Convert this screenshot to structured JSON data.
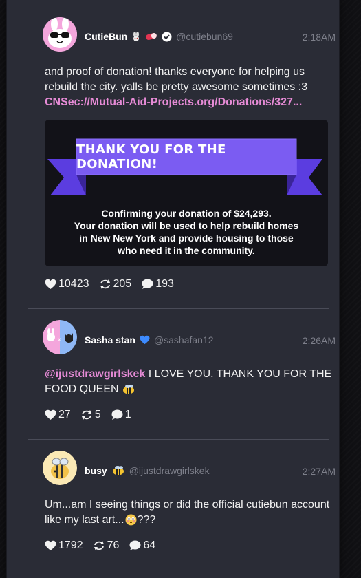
{
  "posts": [
    {
      "name": "CutieBun",
      "handle": "@cutiebun69",
      "time": "2:18AM",
      "text": "and proof of donation! thanks everyone for helping us rebuild the city. yalls be pretty awesome sometimes :3",
      "link": "CNSec://Mutual-Aid-Projects.org/Donations/327...",
      "card": {
        "banner": "THANK YOU FOR THE DONATION!",
        "line1": "Confirming your donation of $24,293.",
        "line2": "Your donation will be used to help rebuild homes",
        "line3": "in New New York and provide housing to those",
        "line4": "who need it in the community."
      },
      "likes": "10423",
      "reposts": "205",
      "replies": "193"
    },
    {
      "name": "Sasha stan",
      "handle": "@sashafan12",
      "time": "2:26AM",
      "mention": "@ijustdrawgirlskek",
      "text": " I LOVE YOU. THANK YOU FOR THE FOOD QUEEN",
      "likes": "27",
      "reposts": "5",
      "replies": "1"
    },
    {
      "name": "busy",
      "handle": "@ijustdrawgirlskek",
      "time": "2:27AM",
      "text": "Um...am I seeing things or did the official cutiebun account like my last art...",
      "text_suffix": "???",
      "likes": "1792",
      "reposts": "76",
      "replies": "64"
    }
  ],
  "colors": {
    "panel": "#2a2c36",
    "accent_pink": "#e68bd6",
    "banner_purple": "#7755f0",
    "verified_blue": "#3d8bff"
  },
  "icons": [
    "heart-icon",
    "repost-icon",
    "reply-icon",
    "verified-icon",
    "bee-emoji-icon",
    "flushed-emoji-icon"
  ]
}
